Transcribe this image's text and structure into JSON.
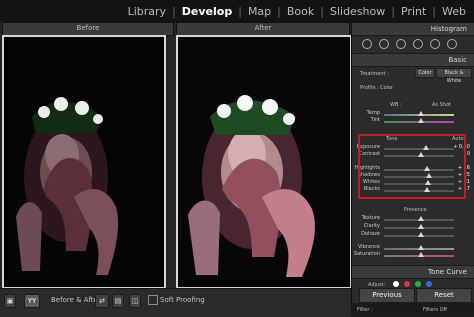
{
  "nav": {
    "items": [
      "Library",
      "Develop",
      "Map",
      "Book",
      "Slideshow",
      "Print",
      "Web"
    ],
    "active": "Develop"
  },
  "viewer": {
    "before_label": "Before",
    "after_label": "After"
  },
  "toolbar": {
    "before_after_label": "Before & After",
    "soft_proofing_label": "Soft Proofing"
  },
  "panel": {
    "histogram_label": "Histogram",
    "basic_label": "Basic",
    "treatment_label": "Treatment :",
    "treatment_color": "Color",
    "treatment_bw": "Black & White",
    "profile_label": "Profile :",
    "profile_value": "Color",
    "wb_label": "WB :",
    "wb_value": "As Shot",
    "temp_label": "Temp",
    "tint_label": "Tint",
    "tone_label": "Tone",
    "auto_label": "Auto",
    "exposure_label": "Exposure",
    "exposure_value": "+ 0.40",
    "contrast_label": "Contrast",
    "contrast_value": "0",
    "highlights_label": "Highlights",
    "highlights_value": "+ 16",
    "shadows_label": "Shadows",
    "shadows_value": "+ 25",
    "whites_label": "Whites",
    "whites_value": "+ 21",
    "blacks_label": "Blacks",
    "blacks_value": "+ 17",
    "presence_label": "Presence",
    "texture_label": "Texture",
    "clarity_label": "Clarity",
    "dehaze_label": "Dehaze",
    "vibrance_label": "Vibrance",
    "saturation_label": "Saturation",
    "tone_curve_label": "Tone Curve",
    "adjust_label": "Adjust:",
    "previous_label": "Previous",
    "reset_label": "Reset",
    "filter_label": "Filter :",
    "filters_off_label": "Filters Off"
  }
}
